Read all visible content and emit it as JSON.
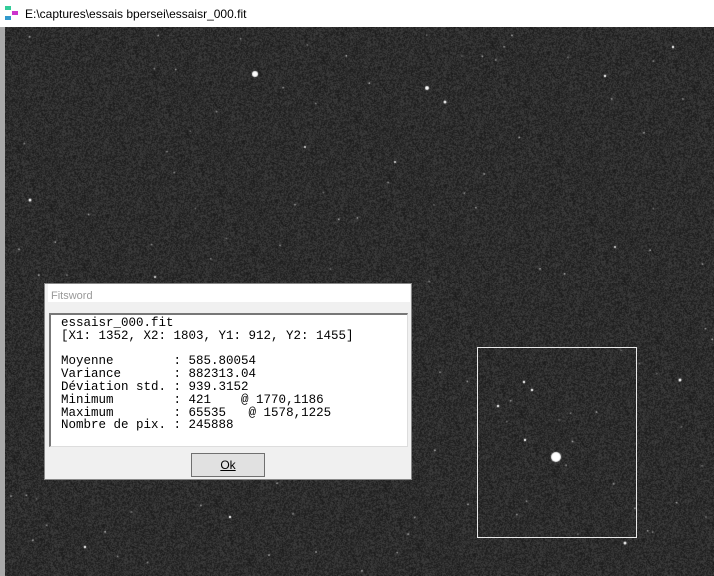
{
  "window": {
    "title": "E:\\captures\\essais bpersei\\essaisr_000.fit",
    "icon": "fitswork-app-icon"
  },
  "dialog": {
    "title": "Fitsword",
    "filename": "essaisr_000.fit",
    "region": "[X1: 1352, X2: 1803, Y1: 912, Y2: 1455]",
    "stats": [
      {
        "label": "Moyenne       ",
        "value": "585.80054"
      },
      {
        "label": "Variance      ",
        "value": "882313.04"
      },
      {
        "label": "Déviation std.",
        "value": "939.3152"
      },
      {
        "label": "Minimum       ",
        "value": "421    @ 1770,1186"
      },
      {
        "label": "Maximum       ",
        "value": "65535   @ 1578,1225"
      },
      {
        "label": "Nombre de pix.",
        "value": "245888"
      }
    ],
    "ok_label": "Ok"
  }
}
